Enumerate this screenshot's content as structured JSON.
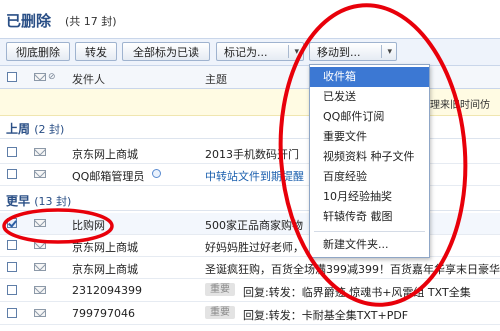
{
  "header": {
    "title": "已删除",
    "count_text": "(共 17 封)"
  },
  "toolbar": {
    "delete_forever": "彻底删除",
    "forward": "转发",
    "mark_all_read": "全部标为已读",
    "mark_as": "标记为...",
    "move_to": "移动到...",
    "dropdown_arrow": "▾"
  },
  "columns": {
    "sender": "发件人",
    "subject": "主题"
  },
  "notice": {
    "text": "清理来旧时间仿"
  },
  "groups": [
    {
      "label": "上周",
      "count": "(2 封)"
    },
    {
      "label": "更早",
      "count": "(13 封)"
    }
  ],
  "rows": [
    {
      "sender": "京东网上商城",
      "subject": "2013手机数码开门",
      "tag": "",
      "checked": false
    },
    {
      "sender": "QQ邮箱管理员",
      "subject": "中转站文件到期提醒",
      "tag": "",
      "checked": false
    },
    {
      "sender": "比购网",
      "subject": "500家正品商家购物",
      "tag": "",
      "checked": true
    },
    {
      "sender": "京东网上商城",
      "subject": "好妈妈胜过好老师，",
      "tag": "",
      "checked": false
    },
    {
      "sender": "京东网上商城",
      "subject": "圣诞疯狂购，百货全场满399减399！百货嘉年华享末日豪华大",
      "tag": "",
      "checked": false
    },
    {
      "sender": "2312094399",
      "subject": "回复:转发：临界爵迹 惊魂书+风雷组 TXT全集",
      "tag": "重要",
      "checked": false
    },
    {
      "sender": "799797046",
      "subject": "回复:转发：卡耐基全集TXT+PDF",
      "tag": "重要",
      "checked": false
    }
  ],
  "move_menu": {
    "items": [
      "收件箱",
      "已发送",
      "QQ邮件订阅",
      "重要文件",
      "视频资料 种子文件",
      "百度经验",
      "10月经验抽奖",
      "轩辕传奇 截图",
      "新建文件夹..."
    ],
    "active_index": 0
  },
  "colors": {
    "accent": "#2a4f86",
    "menu_highlight": "#3c78d3",
    "annotation": "#e8000a"
  }
}
